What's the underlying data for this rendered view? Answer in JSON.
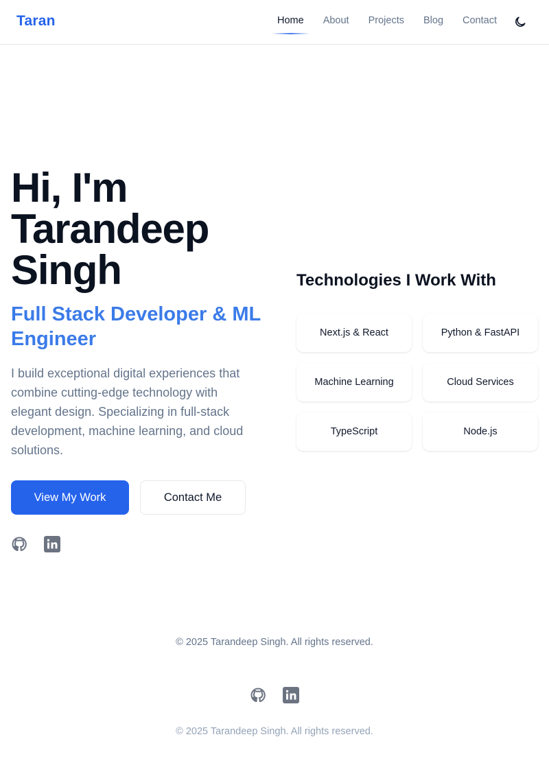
{
  "nav": {
    "logo": "Taran",
    "links": [
      {
        "label": "Home",
        "active": true
      },
      {
        "label": "About",
        "active": false
      },
      {
        "label": "Projects",
        "active": false
      },
      {
        "label": "Blog",
        "active": false
      },
      {
        "label": "Contact",
        "active": false
      }
    ],
    "theme_toggle_icon": "moon-icon"
  },
  "hero": {
    "title": "Hi, I'm Tarandeep Singh",
    "subtitle": "Full Stack Developer & ML Engineer",
    "description": "I build exceptional digital experiences that combine cutting-edge technology with elegant design. Specializing in full-stack development, machine learning, and cloud solutions.",
    "primary_button": "View My Work",
    "secondary_button": "Contact Me",
    "social_icons": [
      "github-icon",
      "linkedin-icon"
    ]
  },
  "technologies": {
    "title": "Technologies I Work With",
    "items": [
      "Next.js & React",
      "Python & FastAPI",
      "Machine Learning",
      "Cloud Services",
      "TypeScript",
      "Node.js"
    ]
  },
  "footer": {
    "copyright_main": "© 2025 Tarandeep Singh. All rights reserved.",
    "copyright_bottom": "© 2025 Tarandeep Singh. All rights reserved.",
    "social_icons": [
      "github-icon",
      "linkedin-icon"
    ]
  },
  "colors": {
    "accent": "#2563eb",
    "subtitle": "#3b7be8",
    "muted_text": "#64748b",
    "heading": "#0b1220"
  }
}
